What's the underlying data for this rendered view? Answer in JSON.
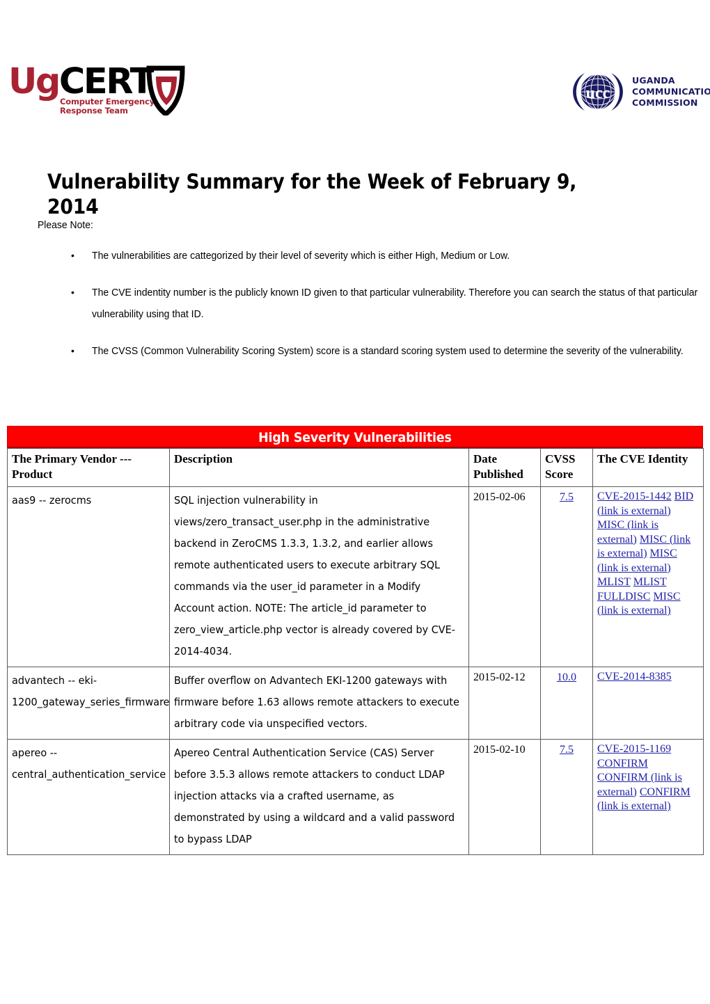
{
  "header": {
    "left_logo": {
      "name": "ugcert-logo",
      "word_prefix": "Ug",
      "word_suffix": "CERT",
      "tagline_line1": "Computer Emergency",
      "tagline_line2": "Response Team",
      "color_red": "#a82332",
      "color_black": "#000000"
    },
    "right_logo": {
      "name": "ucc-logo",
      "mark_text": "ucc",
      "text_line1": "UGANDA",
      "text_line2": "COMMUNICATIONS",
      "text_line3": "COMMISSION",
      "color_navy": "#1b1b63"
    }
  },
  "document": {
    "title": "Vulnerability Summary for the Week of February 9, 2014",
    "please_note_label": "Please Note:",
    "bullet_glyph": "•",
    "notes": [
      "The vulnerabilities are cattegorized by their level of severity which is either High, Medium or Low.",
      "The CVE indentity number is the publicly known ID given to that particular vulnerability. Therefore you can search the status of that particular vulnerability using that ID.",
      "The CVSS (Common Vulnerability Scoring System) score is a standard  scoring system used to determine the severity of the vulnerability."
    ]
  },
  "table": {
    "banner": "High Severity Vulnerabilities",
    "banner_bg": "#ff0000",
    "banner_fg": "#ffffff",
    "link_color": "#2222aa",
    "headers": [
      "The Primary Vendor --- Product",
      "Description",
      "Date Published",
      "CVSS Score",
      "The CVE Identity"
    ],
    "rows": [
      {
        "vendor": "aas9 -- zerocms",
        "description": "SQL injection vulnerability in views/zero_transact_user.php in the administrative backend in ZeroCMS 1.3.3, 1.3.2, and earlier allows remote authenticated users to execute arbitrary SQL commands via the user_id parameter in a Modify Account action. NOTE: The article_id parameter to zero_view_article.php vector is already covered by CVE-2014-4034.",
        "date_published": "2015-02-06",
        "cvss_score": "7.5",
        "cve_links": [
          "CVE-2015-1442",
          "BID (link is external)",
          "MISC (link is external)",
          "MISC (link is external)",
          "MISC (link is external)",
          "MLIST",
          "MLIST",
          "FULLDISC",
          "MISC (link is external)"
        ]
      },
      {
        "vendor": "advantech -- eki-1200_gateway_series_firmware",
        "description": "Buffer overflow on Advantech EKI-1200 gateways with firmware before 1.63 allows remote attackers to execute arbitrary code via unspecified vectors.",
        "date_published": "2015-02-12",
        "cvss_score": "10.0",
        "cve_links": [
          "CVE-2014-8385"
        ]
      },
      {
        "vendor": "apereo -- central_authentication_service",
        "description": "Apereo Central Authentication Service (CAS) Server before 3.5.3 allows remote attackers to conduct LDAP injection attacks via a crafted username, as demonstrated by using a wildcard and a valid password to bypass LDAP",
        "date_published": "2015-02-10",
        "cvss_score": "7.5",
        "cve_links": [
          "CVE-2015-1169",
          "CONFIRM",
          "CONFIRM (link is external)",
          "CONFIRM (link is external)"
        ]
      }
    ]
  }
}
